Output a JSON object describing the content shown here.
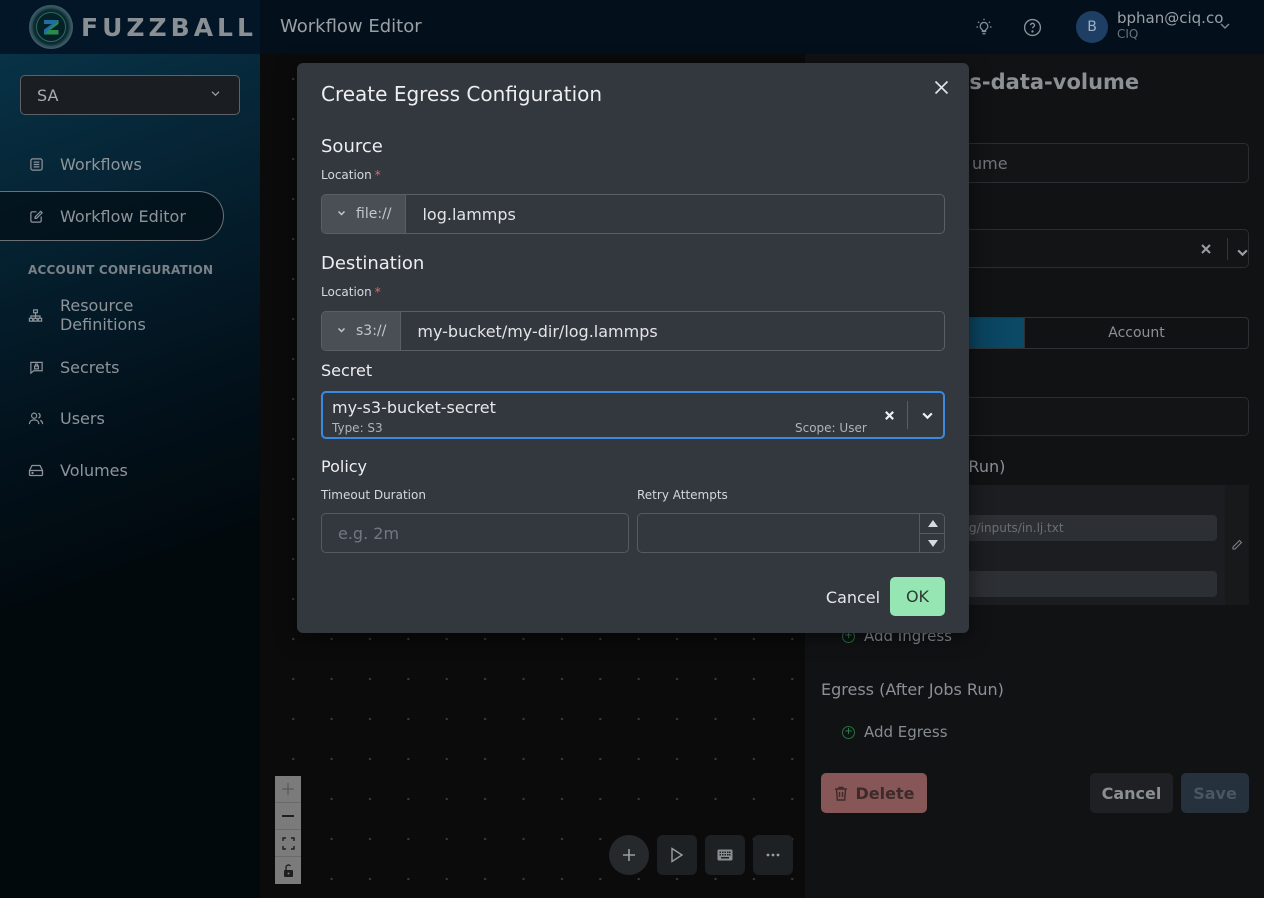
{
  "header": {
    "brand": "FUZZBALL",
    "page_title": "Workflow Editor",
    "icons": [
      "lightbulb-icon",
      "help-circle-icon"
    ],
    "user": {
      "avatar_initial": "B",
      "email": "bphan@ciq.co",
      "org": "CIQ"
    }
  },
  "sidebar": {
    "account_select": "SA",
    "items": [
      {
        "label": "Workflows",
        "icon": "list-icon",
        "active": false
      },
      {
        "label": "Workflow Editor",
        "icon": "edit-icon",
        "active": true
      }
    ],
    "section_label": "ACCOUNT CONFIGURATION",
    "config_items": [
      {
        "label": "Resource Definitions",
        "icon": "hierarchy-icon"
      },
      {
        "label": "Secrets",
        "icon": "secret-icon"
      },
      {
        "label": "Users",
        "icon": "users-icon"
      },
      {
        "label": "Volumes",
        "icon": "drive-icon"
      }
    ]
  },
  "canvas": {
    "zoom_controls": [
      "+",
      "—",
      "⛶",
      "🔓"
    ],
    "fabs": [
      "+",
      "▷",
      "⌨",
      "···"
    ]
  },
  "right_panel": {
    "title_visible": "os-data-volume",
    "name_value_visible": "ume",
    "segment_b": "Account",
    "ingress_heading_visible": "s Run)",
    "ingress_field_1_visible": "g/inputs/in.lj.txt",
    "add_ingress": "Add Ingress",
    "egress_heading": "Egress (After Jobs Run)",
    "add_egress": "Add Egress",
    "delete_label": "Delete",
    "cancel_label": "Cancel",
    "save_label": "Save"
  },
  "modal": {
    "title": "Create Egress Configuration",
    "source": {
      "heading": "Source",
      "location_label": "Location",
      "required_mark": "*",
      "prefix": "file://",
      "value": "log.lammps"
    },
    "destination": {
      "heading": "Destination",
      "location_label": "Location",
      "required_mark": "*",
      "prefix": "s3://",
      "value": "my-bucket/my-dir/log.lammps"
    },
    "secret": {
      "heading": "Secret",
      "name": "my-s3-bucket-secret",
      "type": "Type: S3",
      "scope": "Scope: User"
    },
    "policy": {
      "heading": "Policy",
      "timeout_label": "Timeout Duration",
      "timeout_placeholder": "e.g. 2m",
      "timeout_value": "",
      "retry_label": "Retry Attempts",
      "retry_value": ""
    },
    "cancel_label": "Cancel",
    "ok_label": "OK"
  }
}
